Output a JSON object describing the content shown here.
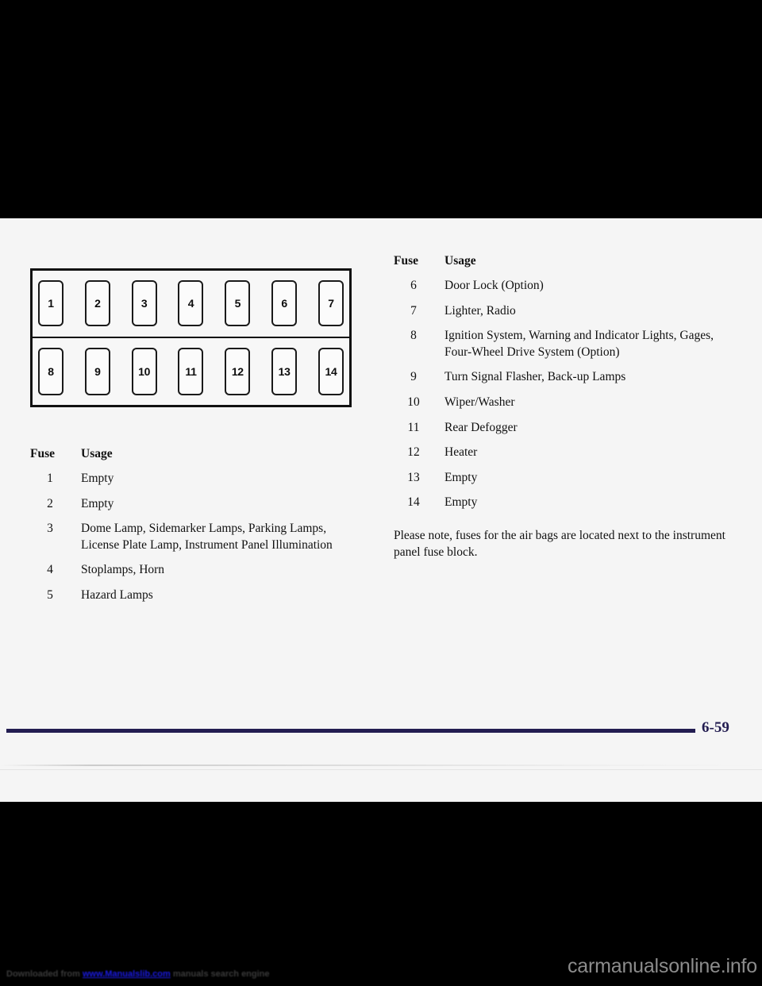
{
  "page": {
    "folio": "6-59",
    "accent_color": "#231d51",
    "sheet_background": "#f5f5f5",
    "band_color": "#000000"
  },
  "diagram": {
    "name": "fuse-block-diagram",
    "top_row": [
      "1",
      "2",
      "3",
      "4",
      "5",
      "6",
      "7"
    ],
    "bottom_row": [
      "8",
      "9",
      "10",
      "11",
      "12",
      "13",
      "14"
    ]
  },
  "table_headers": {
    "fuse": "Fuse",
    "usage": "Usage"
  },
  "left_column": {
    "entries": [
      {
        "num": "1",
        "desc": "Empty"
      },
      {
        "num": "2",
        "desc": "Empty"
      },
      {
        "num": "3",
        "desc": "Dome Lamp, Sidemarker Lamps, Parking Lamps, License Plate Lamp, Instrument Panel Illumination"
      },
      {
        "num": "4",
        "desc": "Stoplamps, Horn"
      },
      {
        "num": "5",
        "desc": "Hazard Lamps"
      }
    ]
  },
  "right_column": {
    "entries": [
      {
        "num": "6",
        "desc": "Door Lock (Option)"
      },
      {
        "num": "7",
        "desc": "Lighter, Radio"
      },
      {
        "num": "8",
        "desc": "Ignition System, Warning and Indicator Lights, Gages, Four-Wheel Drive System (Option)"
      },
      {
        "num": "9",
        "desc": "Turn Signal Flasher, Back-up Lamps"
      },
      {
        "num": "10",
        "desc": "Wiper/Washer"
      },
      {
        "num": "11",
        "desc": "Rear Defogger"
      },
      {
        "num": "12",
        "desc": "Heater"
      },
      {
        "num": "13",
        "desc": "Empty"
      },
      {
        "num": "14",
        "desc": "Empty"
      }
    ],
    "note": "Please note, fuses for the air bags are located next to the instrument panel fuse block."
  },
  "watermark": {
    "left_prefix": "Downloaded from ",
    "left_url": "www.Manualslib.com",
    "left_suffix": " manuals search engine",
    "right": "carmanualsonline.info"
  }
}
